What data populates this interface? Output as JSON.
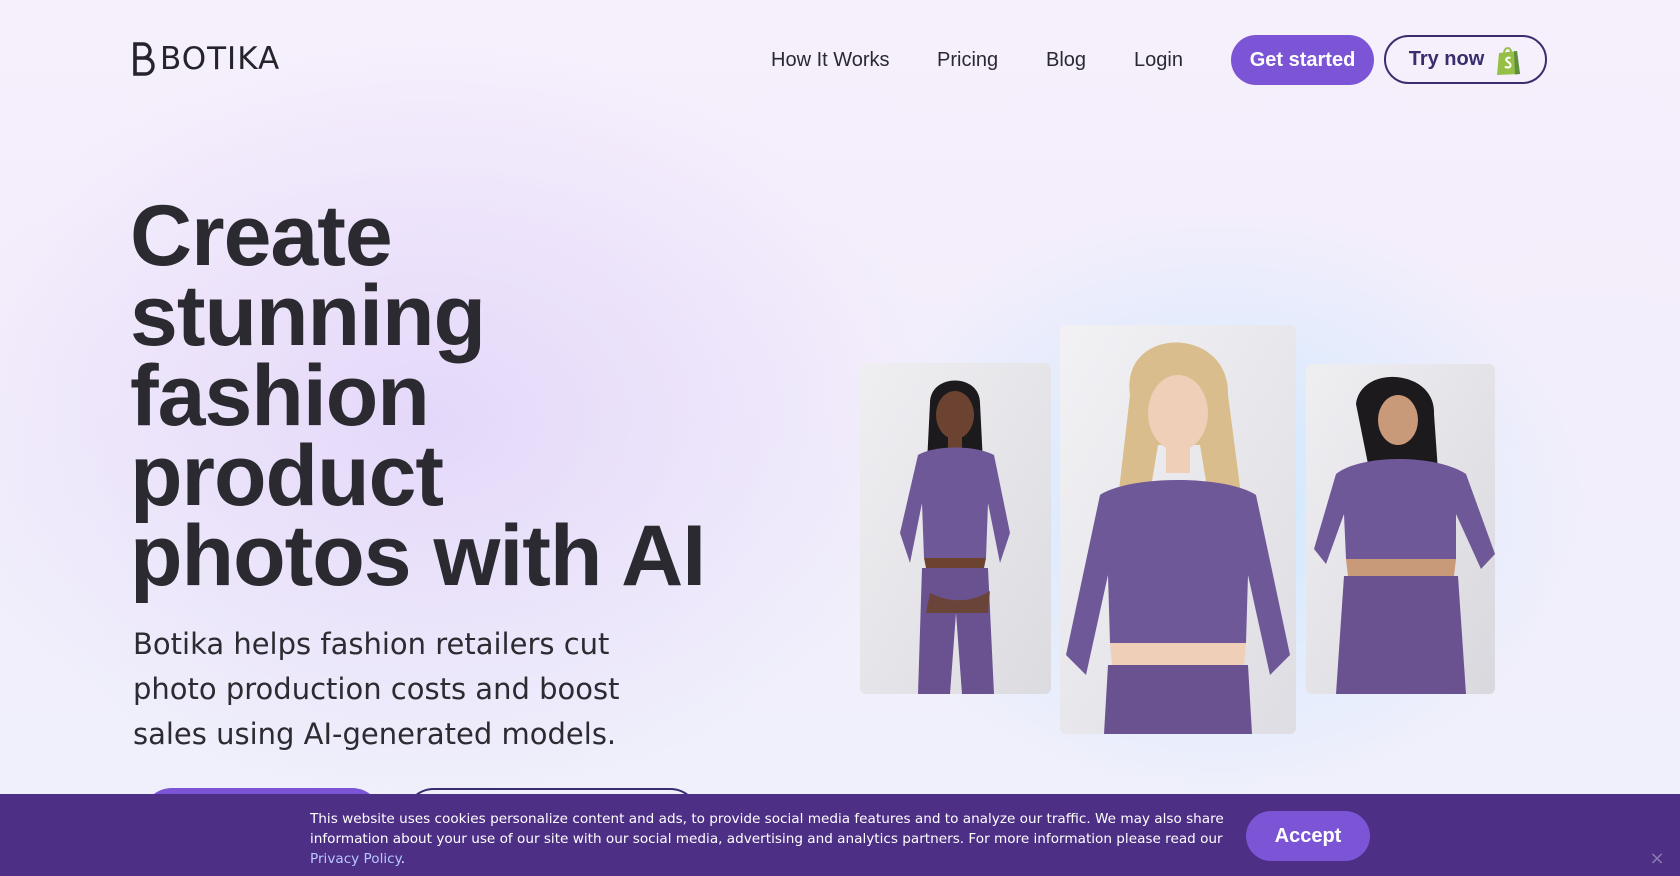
{
  "brand": {
    "name": "BOTIKA",
    "logo_icon": "botika-b-logo-icon"
  },
  "nav": {
    "links": [
      "How It Works",
      "Pricing",
      "Blog",
      "Login"
    ],
    "get_started": "Get started",
    "try_now": "Try now",
    "try_now_icon": "shopify-bag-icon"
  },
  "hero": {
    "title_lines": [
      "Create",
      "stunning",
      "fashion",
      "product",
      "photos with AI"
    ],
    "subtitle": "Botika helps fashion retailers cut photo production costs and boost sales using AI-generated models."
  },
  "photos": {
    "outfit_color": "#6f5897"
  },
  "cookie": {
    "text": "This website uses cookies personalize content and ads, to provide social media features and to analyze our traffic. We may also share information about your use of our site with our social media, advertising and analytics partners. For more information please read our ",
    "link": "Privacy Policy",
    "end": ".",
    "accept": "Accept",
    "close": "×"
  },
  "colors": {
    "accent": "#7b55d6",
    "dark_outline": "#3a2d6e",
    "cookie_bg": "#4d2f86"
  }
}
